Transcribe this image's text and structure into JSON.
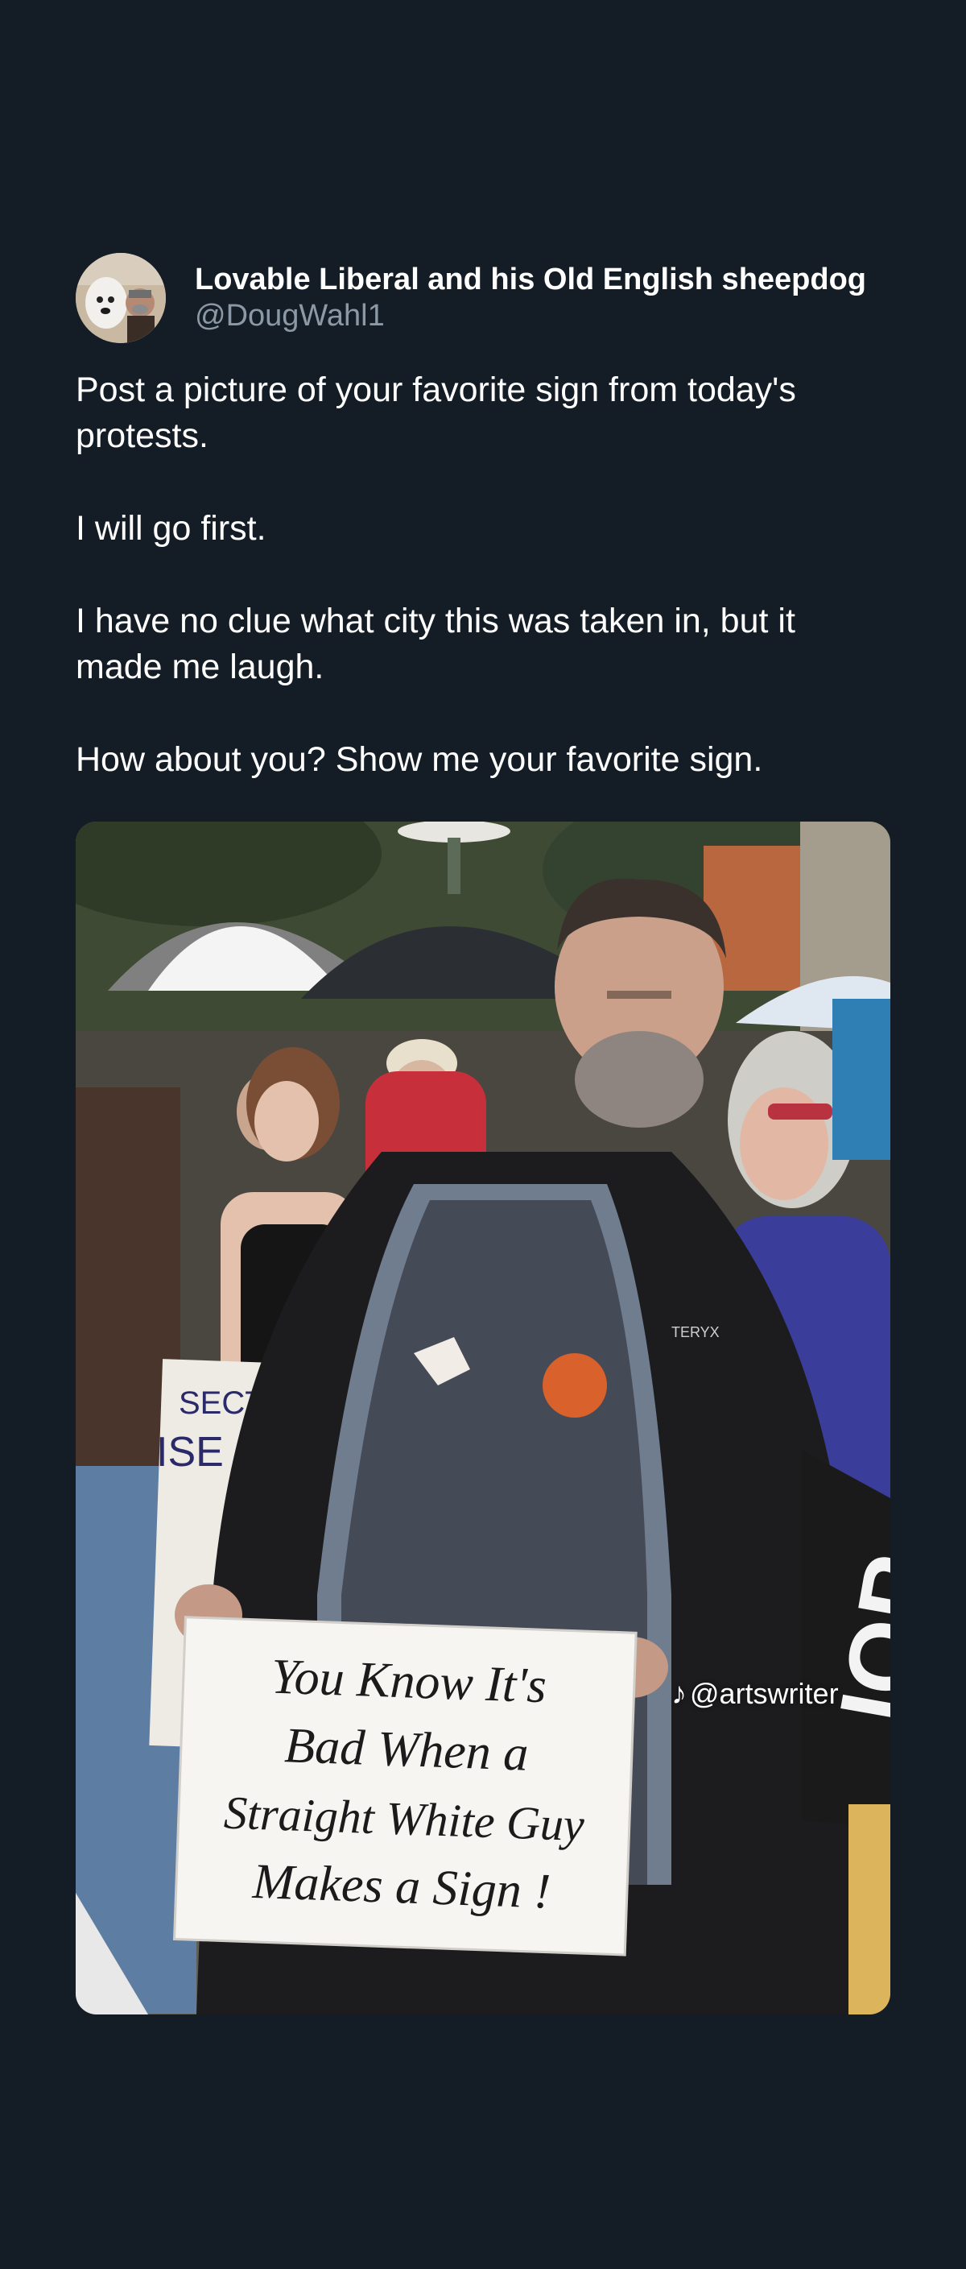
{
  "tweet": {
    "display_name": "Lovable Liberal and his Old English sheepdog",
    "handle": "@DougWahl1",
    "paragraphs": [
      "Post a picture of your favorite sign from today's protests.",
      "I will go first.",
      "I have no clue what city this was taken in, but it made me laugh.",
      "How about you? Show me your favorite sign."
    ],
    "media": {
      "sign_lines": [
        "You Know It's",
        "Bad When a",
        "Straight White Guy",
        "Makes a Sign !"
      ],
      "background_sign_lines": [
        "SECTION",
        "ISE 8"
      ],
      "right_sign_text": "IOP",
      "jacket_brand": "TERYX",
      "watermark": "@artswriter",
      "watermark_icon": "tiktok-icon"
    }
  }
}
